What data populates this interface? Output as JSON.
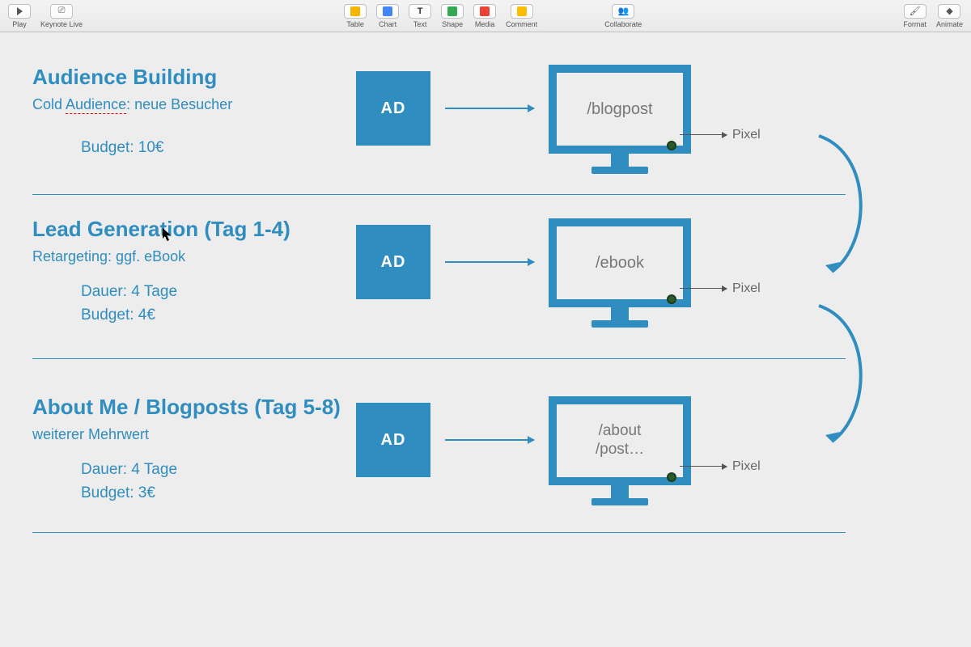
{
  "toolbar": {
    "left": {
      "play": "Play",
      "live": "Keynote Live"
    },
    "center": {
      "items": [
        {
          "label": "Table",
          "color": "#f4b400"
        },
        {
          "label": "Chart",
          "color": "#4285f4"
        },
        {
          "label": "Text",
          "glyph": "T"
        },
        {
          "label": "Shape",
          "color": "#34a853"
        },
        {
          "label": "Media",
          "color": "#ea4335"
        },
        {
          "label": "Comment",
          "color": "#fbbc05"
        }
      ]
    },
    "collab": "Collaborate",
    "right": {
      "format": "Format",
      "animate": "Animate"
    }
  },
  "sections": [
    {
      "title": "Audience Building",
      "subtitle_pre": "Cold ",
      "subtitle_underlined": "Audience",
      "subtitle_post": ": neue Besucher",
      "details": [
        "Budget: 10€"
      ],
      "ad": "AD",
      "screen_lines": [
        "/blogpost"
      ],
      "pixel": "Pixel"
    },
    {
      "title": "Lead Generation (Tag 1-4)",
      "subtitle_pre": "Retargeting: ggf. eBook",
      "subtitle_underlined": "",
      "subtitle_post": "",
      "details": [
        "Dauer: 4 Tage",
        "Budget: 4€"
      ],
      "ad": "AD",
      "screen_lines": [
        "/ebook"
      ],
      "pixel": "Pixel"
    },
    {
      "title": "About Me / Blogposts (Tag 5-8)",
      "subtitle_pre": "weiterer Mehrwert",
      "subtitle_underlined": "",
      "subtitle_post": "",
      "details": [
        "Dauer: 4 Tage",
        "Budget: 3€"
      ],
      "ad": "AD",
      "screen_lines": [
        "/about",
        "/post…"
      ],
      "pixel": "Pixel"
    }
  ]
}
